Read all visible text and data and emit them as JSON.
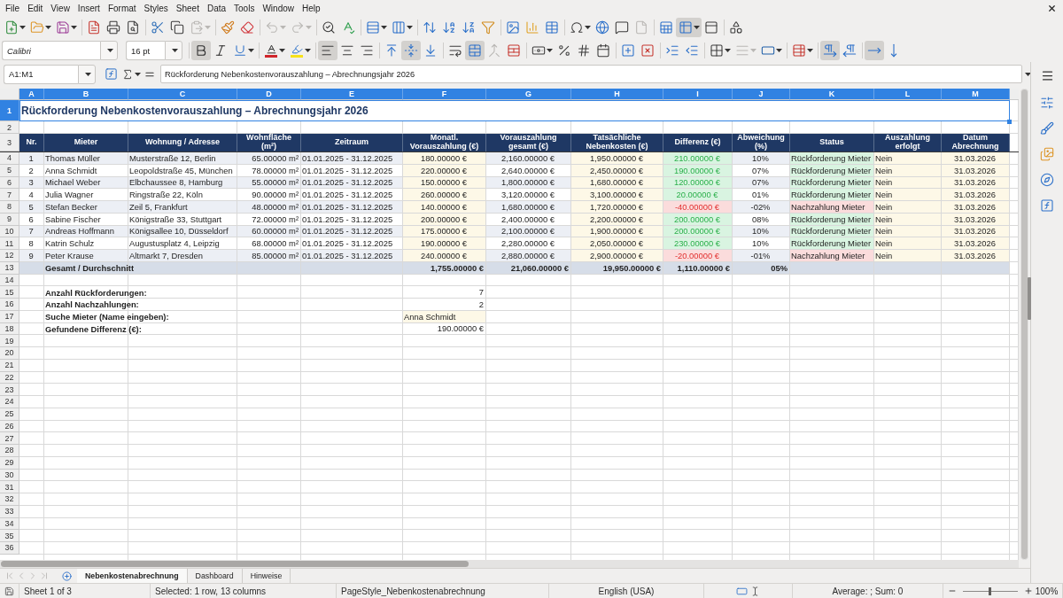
{
  "menu": [
    "File",
    "Edit",
    "View",
    "Insert",
    "Format",
    "Styles",
    "Sheet",
    "Data",
    "Tools",
    "Window",
    "Help"
  ],
  "standard_toolbar": {
    "groups": [
      [
        {
          "kind": "new",
          "pressed": false,
          "disabled": false
        },
        {
          "kind": "open",
          "pressed": false,
          "disabled": false
        },
        {
          "kind": "save",
          "pressed": false,
          "disabled": false
        }
      ],
      [
        {
          "kind": "pdf",
          "pressed": false,
          "disabled": false
        },
        {
          "kind": "print",
          "pressed": false,
          "disabled": false
        },
        {
          "kind": "preview",
          "pressed": false,
          "disabled": false
        }
      ],
      [
        {
          "kind": "cut",
          "pressed": false,
          "disabled": false
        },
        {
          "kind": "copy",
          "pressed": false,
          "disabled": false
        },
        {
          "kind": "paste",
          "pressed": false,
          "disabled": true
        }
      ],
      [
        {
          "kind": "clone",
          "pressed": false,
          "disabled": false
        },
        {
          "kind": "clear",
          "pressed": false,
          "disabled": false
        }
      ],
      [
        {
          "kind": "undo",
          "pressed": false,
          "disabled": true
        },
        {
          "kind": "redo",
          "pressed": false,
          "disabled": true
        }
      ],
      [
        {
          "kind": "find",
          "pressed": false,
          "disabled": false
        },
        {
          "kind": "spelling",
          "pressed": false,
          "disabled": false
        }
      ],
      [
        {
          "kind": "row",
          "pressed": false,
          "disabled": false
        },
        {
          "kind": "column",
          "pressed": false,
          "disabled": false
        }
      ],
      [
        {
          "kind": "sort",
          "pressed": false,
          "disabled": false
        },
        {
          "kind": "ascending",
          "pressed": false,
          "disabled": false
        },
        {
          "kind": "descending",
          "pressed": false,
          "disabled": false
        },
        {
          "kind": "autofilter",
          "pressed": false,
          "disabled": false
        }
      ],
      [
        {
          "kind": "image",
          "pressed": false,
          "disabled": false
        },
        {
          "kind": "chart",
          "pressed": false,
          "disabled": false
        },
        {
          "kind": "pivot",
          "pressed": false,
          "disabled": false
        }
      ],
      [
        {
          "kind": "special",
          "pressed": false,
          "disabled": false
        },
        {
          "kind": "hyperlink",
          "pressed": false,
          "disabled": false
        },
        {
          "kind": "comment",
          "pressed": false,
          "disabled": false
        },
        {
          "kind": "headerfooter",
          "pressed": false,
          "disabled": true
        }
      ],
      [
        {
          "kind": "printarea",
          "pressed": false,
          "disabled": false
        },
        {
          "kind": "freeze",
          "pressed": true,
          "disabled": false
        },
        {
          "kind": "split",
          "pressed": false,
          "disabled": false
        }
      ],
      [
        {
          "kind": "shapes",
          "pressed": false,
          "disabled": false
        }
      ]
    ]
  },
  "formatting_toolbar": {
    "font_name": "Calibri",
    "font_size": "16 pt",
    "groups": [
      [
        {
          "kind": "bold",
          "pressed": true,
          "disabled": false
        },
        {
          "kind": "italic",
          "pressed": false,
          "disabled": false
        },
        {
          "kind": "underline",
          "pressed": false,
          "disabled": false
        }
      ],
      [
        {
          "kind": "fontcolor",
          "pressed": false,
          "disabled": false
        },
        {
          "kind": "highlight",
          "pressed": false,
          "disabled": false
        }
      ],
      [
        {
          "kind": "left",
          "pressed": true,
          "disabled": false
        },
        {
          "kind": "center",
          "pressed": false,
          "disabled": false
        },
        {
          "kind": "right",
          "pressed": false,
          "disabled": false
        }
      ],
      [
        {
          "kind": "top",
          "pressed": false,
          "disabled": false
        },
        {
          "kind": "middle",
          "pressed": true,
          "disabled": false
        },
        {
          "kind": "bottom",
          "pressed": false,
          "disabled": false
        }
      ],
      [
        {
          "kind": "wrap",
          "pressed": false,
          "disabled": false
        },
        {
          "kind": "mergecenter",
          "pressed": true,
          "disabled": false
        },
        {
          "kind": "merge",
          "pressed": false,
          "disabled": true
        },
        {
          "kind": "unmerge",
          "pressed": false,
          "disabled": false
        }
      ],
      [
        {
          "kind": "currency",
          "pressed": false,
          "disabled": false
        },
        {
          "kind": "percent",
          "pressed": false,
          "disabled": false
        },
        {
          "kind": "number",
          "pressed": false,
          "disabled": false
        },
        {
          "kind": "date",
          "pressed": false,
          "disabled": false
        }
      ],
      [
        {
          "kind": "adddecimal",
          "pressed": false,
          "disabled": false
        },
        {
          "kind": "deletedecimal",
          "pressed": false,
          "disabled": false
        }
      ],
      [
        {
          "kind": "indent",
          "pressed": false,
          "disabled": false
        },
        {
          "kind": "outdent",
          "pressed": false,
          "disabled": false
        }
      ],
      [
        {
          "kind": "borders",
          "pressed": false,
          "disabled": false
        },
        {
          "kind": "borderstyle",
          "pressed": false,
          "disabled": true
        },
        {
          "kind": "bordercolor",
          "pressed": false,
          "disabled": false
        }
      ],
      [
        {
          "kind": "conditional",
          "pressed": false,
          "disabled": false
        }
      ],
      [
        {
          "kind": "ltr",
          "pressed": true,
          "disabled": false
        },
        {
          "kind": "rtl",
          "pressed": false,
          "disabled": false
        }
      ],
      [
        {
          "kind": "horizontal",
          "pressed": true,
          "disabled": false
        },
        {
          "kind": "vertical",
          "pressed": false,
          "disabled": false
        }
      ]
    ]
  },
  "formula_bar": {
    "name_box": "A1:M1",
    "content": "Rückforderung Nebenkostenvorauszahlung – Abrechnungsjahr 2026"
  },
  "sheet": {
    "column_headers": [
      {
        "label": "A",
        "selected": true
      },
      {
        "label": "B",
        "selected": true
      },
      {
        "label": "C",
        "selected": true
      },
      {
        "label": "D",
        "selected": true
      },
      {
        "label": "E",
        "selected": true
      },
      {
        "label": "F",
        "selected": true
      },
      {
        "label": "G",
        "selected": true
      },
      {
        "label": "H",
        "selected": true
      },
      {
        "label": "I",
        "selected": true
      },
      {
        "label": "J",
        "selected": true
      },
      {
        "label": "K",
        "selected": true
      },
      {
        "label": "L",
        "selected": true
      },
      {
        "label": "M",
        "selected": true
      }
    ],
    "row_headers": [
      {
        "label": "1",
        "selected": true
      },
      {
        "label": "2",
        "selected": false
      },
      {
        "label": "3",
        "selected": false
      },
      {
        "label": "4",
        "selected": false
      },
      {
        "label": "5",
        "selected": false
      },
      {
        "label": "6",
        "selected": false
      },
      {
        "label": "7",
        "selected": false
      },
      {
        "label": "8",
        "selected": false
      },
      {
        "label": "9",
        "selected": false
      },
      {
        "label": "10",
        "selected": false
      },
      {
        "label": "11",
        "selected": false
      },
      {
        "label": "12",
        "selected": false
      },
      {
        "label": "13",
        "selected": false
      },
      {
        "label": "14",
        "selected": false
      },
      {
        "label": "15",
        "selected": false
      },
      {
        "label": "16",
        "selected": false
      },
      {
        "label": "17",
        "selected": false
      },
      {
        "label": "18",
        "selected": false
      },
      {
        "label": "19",
        "selected": false
      },
      {
        "label": "20",
        "selected": false
      },
      {
        "label": "21",
        "selected": false
      },
      {
        "label": "22",
        "selected": false
      },
      {
        "label": "23",
        "selected": false
      },
      {
        "label": "24",
        "selected": false
      },
      {
        "label": "25",
        "selected": false
      },
      {
        "label": "26",
        "selected": false
      },
      {
        "label": "27",
        "selected": false
      },
      {
        "label": "28",
        "selected": false
      },
      {
        "label": "29",
        "selected": false
      },
      {
        "label": "30",
        "selected": false
      },
      {
        "label": "31",
        "selected": false
      },
      {
        "label": "32",
        "selected": false
      },
      {
        "label": "33",
        "selected": false
      },
      {
        "label": "34",
        "selected": false
      },
      {
        "label": "35",
        "selected": false
      },
      {
        "label": "36",
        "selected": false
      }
    ],
    "title": "Rückforderung Nebenkostenvorauszahlung – Abrechnungsjahr 2026",
    "table": {
      "columns": [
        "Nr.",
        "Mieter",
        "Wohnung / Adresse",
        "Wohnfläche (m²)",
        "Zeitraum",
        "Monatl. Vorauszahlung (€)",
        "Vorauszahlung gesamt (€)",
        "Tatsächliche Nebenkosten (€)",
        "Differenz (€)",
        "Abweichung (%)",
        "Status",
        "Auszahlung erfolgt",
        "Datum Abrechnung"
      ],
      "rows": [
        {
          "kind": "refund",
          "cells": [
            "1",
            "Thomas Müller",
            "Musterstraße 12, Berlin",
            "65.00000 m²",
            "01.01.2025 - 31.12.2025",
            "180.00000 €",
            "2,160.00000 €",
            "1,950.00000 €",
            "210.00000 €",
            "10%",
            "Rückforderung Mieter",
            "Nein",
            "31.03.2026"
          ]
        },
        {
          "kind": "refund",
          "cells": [
            "2",
            "Anna Schmidt",
            "Leopoldstraße 45, München",
            "78.00000 m²",
            "01.01.2025 - 31.12.2025",
            "220.00000 €",
            "2,640.00000 €",
            "2,450.00000 €",
            "190.00000 €",
            "07%",
            "Rückforderung Mieter",
            "Nein",
            "31.03.2026"
          ]
        },
        {
          "kind": "refund",
          "cells": [
            "3",
            "Michael Weber",
            "Elbchaussee 8, Hamburg",
            "55.00000 m²",
            "01.01.2025 - 31.12.2025",
            "150.00000 €",
            "1,800.00000 €",
            "1,680.00000 €",
            "120.00000 €",
            "07%",
            "Rückforderung Mieter",
            "Nein",
            "31.03.2026"
          ]
        },
        {
          "kind": "refund",
          "cells": [
            "4",
            "Julia Wagner",
            "Ringstraße 22, Köln",
            "90.00000 m²",
            "01.01.2025 - 31.12.2025",
            "260.00000 €",
            "3,120.00000 €",
            "3,100.00000 €",
            "20.00000 €",
            "01%",
            "Rückforderung Mieter",
            "Nein",
            "31.03.2026"
          ]
        },
        {
          "kind": "backpay",
          "cells": [
            "5",
            "Stefan Becker",
            "Zeil 5, Frankfurt",
            "48.00000 m²",
            "01.01.2025 - 31.12.2025",
            "140.00000 €",
            "1,680.00000 €",
            "1,720.00000 €",
            "-40.00000 €",
            "-02%",
            "Nachzahlung Mieter",
            "Nein",
            "31.03.2026"
          ]
        },
        {
          "kind": "refund",
          "cells": [
            "6",
            "Sabine Fischer",
            "Königstraße 33, Stuttgart",
            "72.00000 m²",
            "01.01.2025 - 31.12.2025",
            "200.00000 €",
            "2,400.00000 €",
            "2,200.00000 €",
            "200.00000 €",
            "08%",
            "Rückforderung Mieter",
            "Nein",
            "31.03.2026"
          ]
        },
        {
          "kind": "refund",
          "cells": [
            "7",
            "Andreas Hoffmann",
            "Königsallee 10, Düsseldorf",
            "60.00000 m²",
            "01.01.2025 - 31.12.2025",
            "175.00000 €",
            "2,100.00000 €",
            "1,900.00000 €",
            "200.00000 €",
            "10%",
            "Rückforderung Mieter",
            "Nein",
            "31.03.2026"
          ]
        },
        {
          "kind": "refund",
          "cells": [
            "8",
            "Katrin Schulz",
            "Augustusplatz 4, Leipzig",
            "68.00000 m²",
            "01.01.2025 - 31.12.2025",
            "190.00000 €",
            "2,280.00000 €",
            "2,050.00000 €",
            "230.00000 €",
            "10%",
            "Rückforderung Mieter",
            "Nein",
            "31.03.2026"
          ]
        },
        {
          "kind": "backpay",
          "cells": [
            "9",
            "Peter Krause",
            "Altmarkt 7, Dresden",
            "85.00000 m²",
            "01.01.2025 - 31.12.2025",
            "240.00000 €",
            "2,880.00000 €",
            "2,900.00000 €",
            "-20.00000 €",
            "-01%",
            "Nachzahlung Mieter",
            "Nein",
            "31.03.2026"
          ]
        }
      ],
      "total": {
        "label": "Gesamt / Durchschnitt",
        "monthly": "1,755.00000 €",
        "prepaid": "21,060.00000 €",
        "actual": "19,950.00000 €",
        "difference": "1,110.00000 €",
        "deviation": "05%"
      }
    },
    "summary": [
      {
        "label": "Anzahl Rückforderungen:",
        "value": "7",
        "kind": "number"
      },
      {
        "label": "Anzahl Nachzahlungen:",
        "value": "2",
        "kind": "number"
      },
      {
        "label": "Suche Mieter (Name eingeben):",
        "value": "Anna Schmidt",
        "kind": "input"
      },
      {
        "label": "Gefundene Differenz (€):",
        "value": "190.00000 €",
        "kind": "number"
      }
    ]
  },
  "sheet_tabs": {
    "navigation": [
      {
        "kind": "first",
        "disabled": true
      },
      {
        "kind": "previous",
        "disabled": true
      },
      {
        "kind": "next",
        "disabled": true
      },
      {
        "kind": "last",
        "disabled": true
      }
    ],
    "tabs": [
      {
        "label": "Nebenkostenabrechnung",
        "selected": true
      },
      {
        "label": "Dashboard",
        "selected": false
      },
      {
        "label": "Hinweise",
        "selected": false
      }
    ]
  },
  "status_bar": {
    "sheet": "Sheet 1 of 3",
    "selection": "Selected: 1 row, 13 columns",
    "page_style": "PageStyle_Nebenkostenabrechnung",
    "language": "English (USA)",
    "summary": "Average: ; Sum: 0",
    "zoom": {
      "level": 0.5,
      "label": "100%"
    }
  }
}
